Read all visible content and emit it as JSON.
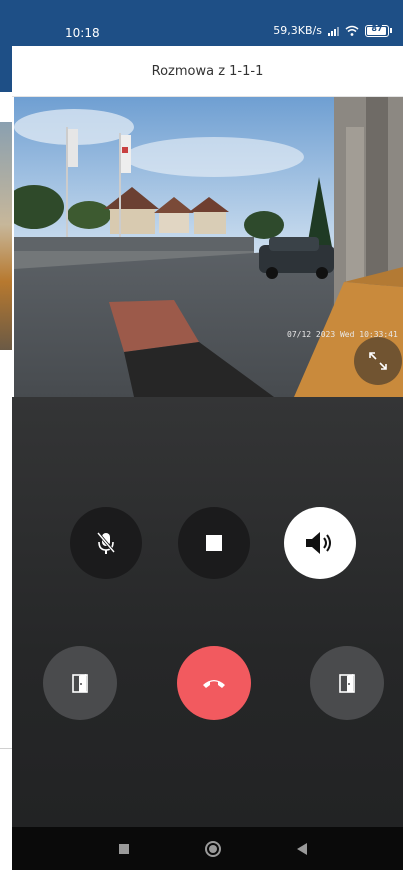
{
  "status": {
    "time": "10:18",
    "network_speed": "59,3KB/s",
    "battery": "87"
  },
  "title": "Rozmowa z 1-1-1",
  "video": {
    "timestamp": "07/12 2023 Wed 10:33:41",
    "expand_icon": "expand-icon"
  },
  "controls": {
    "mute": "mic-off-icon",
    "stop": "stop-icon",
    "speaker": "speaker-icon",
    "door_left": "door-open-icon",
    "hangup": "hangup-icon",
    "door_right": "door-open-icon"
  },
  "colors": {
    "status_bar": "#1e4f86",
    "hangup": "#f25a5f",
    "speaker_active": "#ffffff"
  },
  "navbar": [
    "square-icon",
    "home-circle-icon",
    "back-triangle-icon"
  ]
}
